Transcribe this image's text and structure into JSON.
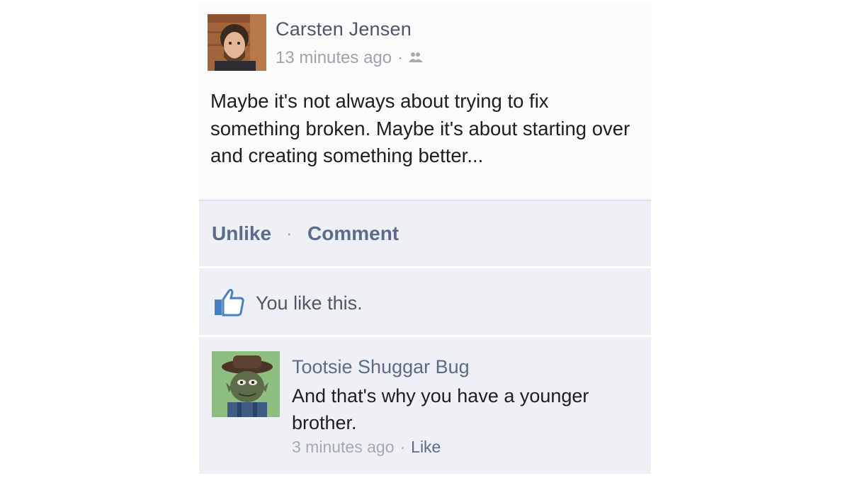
{
  "post": {
    "author": "Carsten Jensen",
    "timestamp": "13 minutes ago",
    "separator": "·",
    "audience_icon": "friends-icon",
    "text": "Maybe it's not always about trying to fix something broken. Maybe it's about starting over and creating something better..."
  },
  "actions": {
    "unlike_label": "Unlike",
    "separator": "·",
    "comment_label": "Comment"
  },
  "likes": {
    "icon": "thumbs-up-icon",
    "text": "You like this."
  },
  "comment": {
    "author": "Tootsie Shuggar Bug",
    "text": "And that's why you have a younger brother.",
    "timestamp": "3 minutes ago",
    "separator": "·",
    "like_label": "Like"
  },
  "colors": {
    "link": "#5b6b89",
    "thumb": "#4a7fc1",
    "background": "#eef0f5"
  }
}
